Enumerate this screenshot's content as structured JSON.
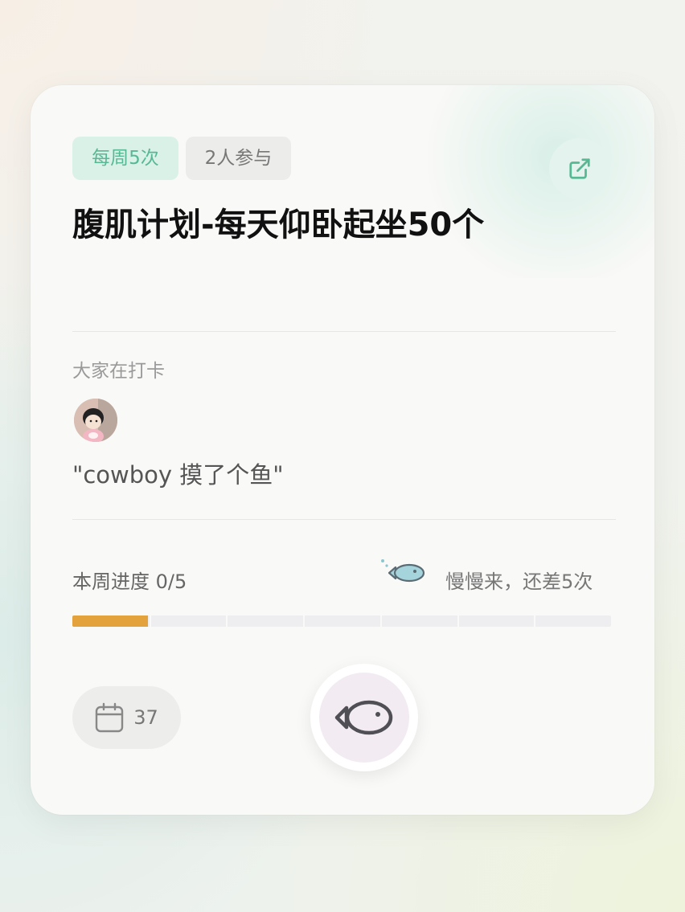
{
  "tags": {
    "frequency": "每周5次",
    "participants": "2人参与"
  },
  "title": "腹肌计划-每天仰卧起坐50个",
  "checkin": {
    "label": "大家在打卡",
    "message": "\"cowboy 摸了个鱼\""
  },
  "progress": {
    "label": "本周进度 0/5",
    "status": "慢慢来，还差5次",
    "fill_fraction": 0.14,
    "segments": 7,
    "color": "#e3a23c"
  },
  "days": {
    "count": "37"
  },
  "icons": {
    "share": "external-link-icon",
    "calendar": "calendar-icon",
    "fish": "fish-icon"
  },
  "colors": {
    "accent": "#57b894",
    "tag_bg": "#daf1e8"
  }
}
